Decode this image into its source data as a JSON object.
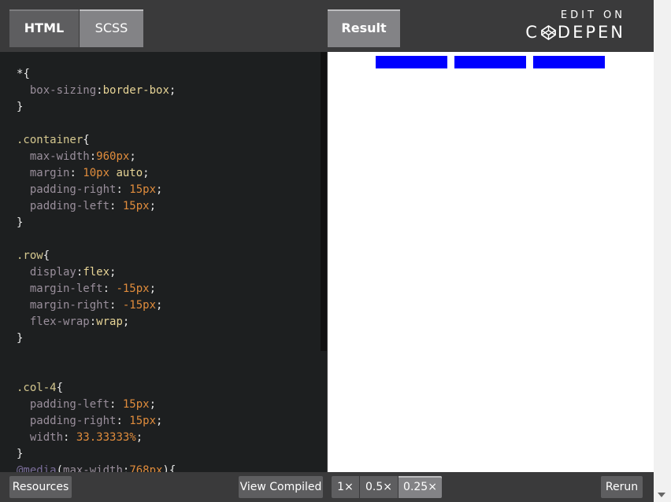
{
  "tabs": {
    "html": "HTML",
    "scss": "SCSS",
    "result": "Result"
  },
  "brand": {
    "edit_on": "EDIT ON",
    "codepen_pre": "C",
    "codepen_post": "DEPEN"
  },
  "code": {
    "l1_sel": "*",
    "l1_brace": "{",
    "l2_prop": "box-sizing",
    "l2_val": "border-box",
    "l3": "}",
    "l5_sel": ".container",
    "l5_brace": "{",
    "l6_prop": "max-width",
    "l6_val": "960px",
    "l7_prop": "margin",
    "l7_num": "10px",
    "l7_kw": "auto",
    "l8_prop": "padding-right",
    "l8_val": "15px",
    "l9_prop": "padding-left",
    "l9_val": "15px",
    "l10": "}",
    "l12_sel": ".row",
    "l12_brace": "{",
    "l13_prop": "display",
    "l13_val": "flex",
    "l14_prop": "margin-left",
    "l14_val": "-15px",
    "l15_prop": "margin-right",
    "l15_val": "-15px",
    "l16_prop": "flex-wrap",
    "l16_val": "wrap",
    "l17": "}",
    "l20_sel": ".col-4",
    "l20_brace": "{",
    "l21_prop": "padding-left",
    "l21_val": "15px",
    "l22_prop": "padding-right",
    "l22_val": "15px",
    "l23_prop": "width",
    "l23_val": "33.33333%",
    "l24": "}",
    "l25_at": "@media",
    "l25_prop": "max-width",
    "l25_val": "768px"
  },
  "bottom": {
    "resources": "Resources",
    "view_compiled": "View Compiled",
    "zoom_1": "1×",
    "zoom_05": "0.5×",
    "zoom_025": "0.25×",
    "rerun": "Rerun"
  },
  "colors": {
    "result_box": "#0000ff"
  }
}
